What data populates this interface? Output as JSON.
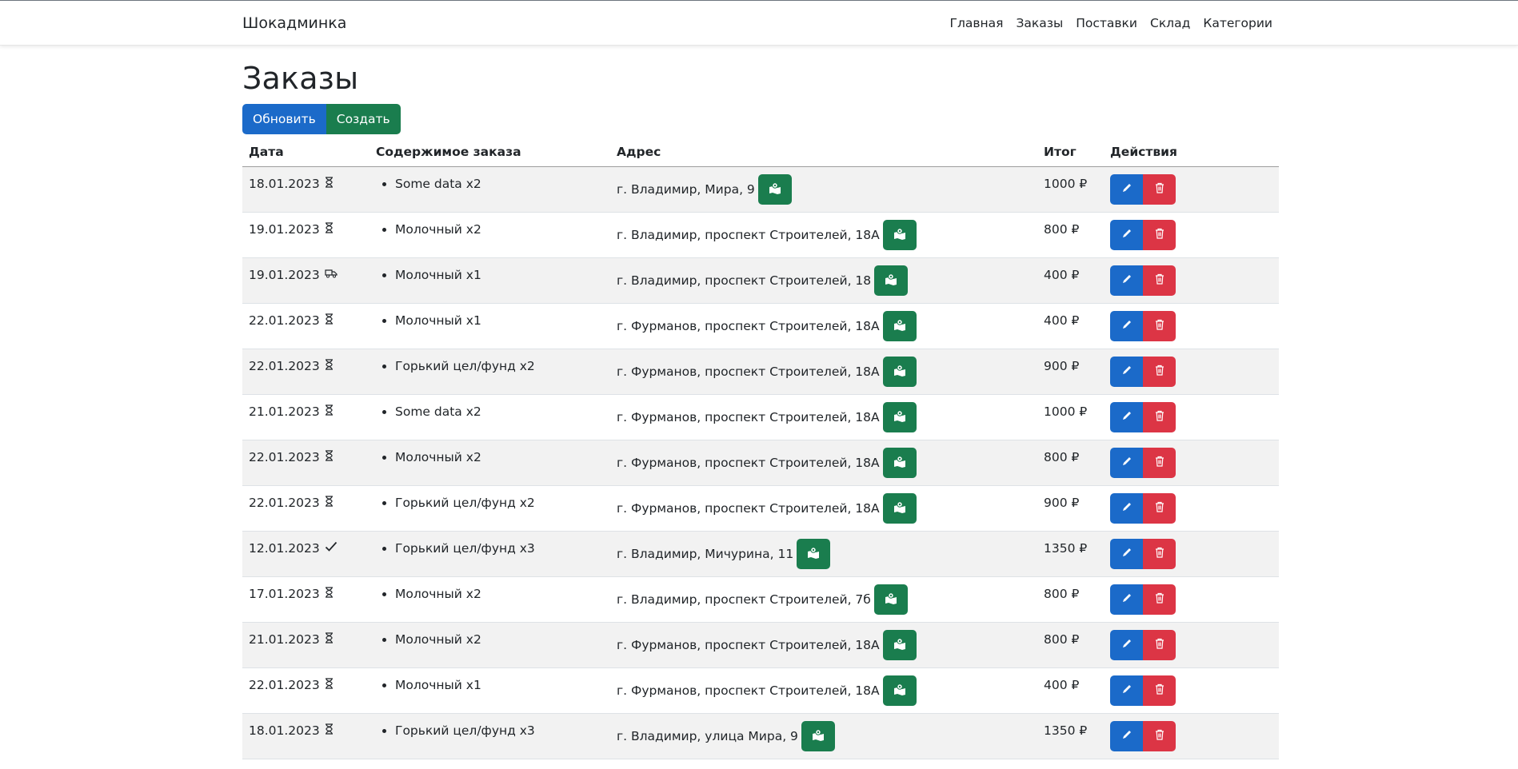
{
  "navbar": {
    "brand": "Шокадминка",
    "links": [
      "Главная",
      "Заказы",
      "Поставки",
      "Склад",
      "Категории"
    ]
  },
  "page": {
    "title": "Заказы",
    "refresh_label": "Обновить",
    "create_label": "Создать"
  },
  "table": {
    "headers": {
      "date": "Дата",
      "content": "Содержимое заказа",
      "address": "Адрес",
      "total": "Итог",
      "actions": "Действия"
    },
    "rows": [
      {
        "date": "18.01.2023",
        "status": "hourglass-icon",
        "items": [
          "Some data x2"
        ],
        "address": "г. Владимир, Мира, 9",
        "total": "1000 ₽"
      },
      {
        "date": "19.01.2023",
        "status": "hourglass-icon",
        "items": [
          "Молочный x2"
        ],
        "address": "г. Владимир, проспект Строителей, 18А",
        "total": "800 ₽"
      },
      {
        "date": "19.01.2023",
        "status": "truck-icon",
        "items": [
          "Молочный x1"
        ],
        "address": "г. Владимир, проспект Строителей, 18",
        "total": "400 ₽"
      },
      {
        "date": "22.01.2023",
        "status": "hourglass-icon",
        "items": [
          "Молочный x1"
        ],
        "address": "г. Фурманов, проспект Строителей, 18А",
        "total": "400 ₽"
      },
      {
        "date": "22.01.2023",
        "status": "hourglass-icon",
        "items": [
          "Горький цел/фунд x2"
        ],
        "address": "г. Фурманов, проспект Строителей, 18А",
        "total": "900 ₽"
      },
      {
        "date": "21.01.2023",
        "status": "hourglass-icon",
        "items": [
          "Some data x2"
        ],
        "address": "г. Фурманов, проспект Строителей, 18А",
        "total": "1000 ₽"
      },
      {
        "date": "22.01.2023",
        "status": "hourglass-icon",
        "items": [
          "Молочный x2"
        ],
        "address": "г. Фурманов, проспект Строителей, 18А",
        "total": "800 ₽"
      },
      {
        "date": "22.01.2023",
        "status": "hourglass-icon",
        "items": [
          "Горький цел/фунд x2"
        ],
        "address": "г. Фурманов, проспект Строителей, 18А",
        "total": "900 ₽"
      },
      {
        "date": "12.01.2023",
        "status": "check-icon",
        "items": [
          "Горький цел/фунд x3"
        ],
        "address": "г. Владимир, Мичурина, 11",
        "total": "1350 ₽"
      },
      {
        "date": "17.01.2023",
        "status": "hourglass-icon",
        "items": [
          "Молочный x2"
        ],
        "address": "г. Владимир, проспект Строителей, 7б",
        "total": "800 ₽"
      },
      {
        "date": "21.01.2023",
        "status": "hourglass-icon",
        "items": [
          "Молочный x2"
        ],
        "address": "г. Фурманов, проспект Строителей, 18А",
        "total": "800 ₽"
      },
      {
        "date": "22.01.2023",
        "status": "hourglass-icon",
        "items": [
          "Молочный x1"
        ],
        "address": "г. Фурманов, проспект Строителей, 18А",
        "total": "400 ₽"
      },
      {
        "date": "18.01.2023",
        "status": "hourglass-icon",
        "items": [
          "Горький цел/фунд x3"
        ],
        "address": "г. Владимир, улица Мира, 9",
        "total": "1350 ₽"
      }
    ]
  },
  "colors": {
    "primary": "#1b6ac9",
    "success": "#1a7d4e",
    "danger": "#dc3545",
    "stripe": "#f2f2f2"
  }
}
